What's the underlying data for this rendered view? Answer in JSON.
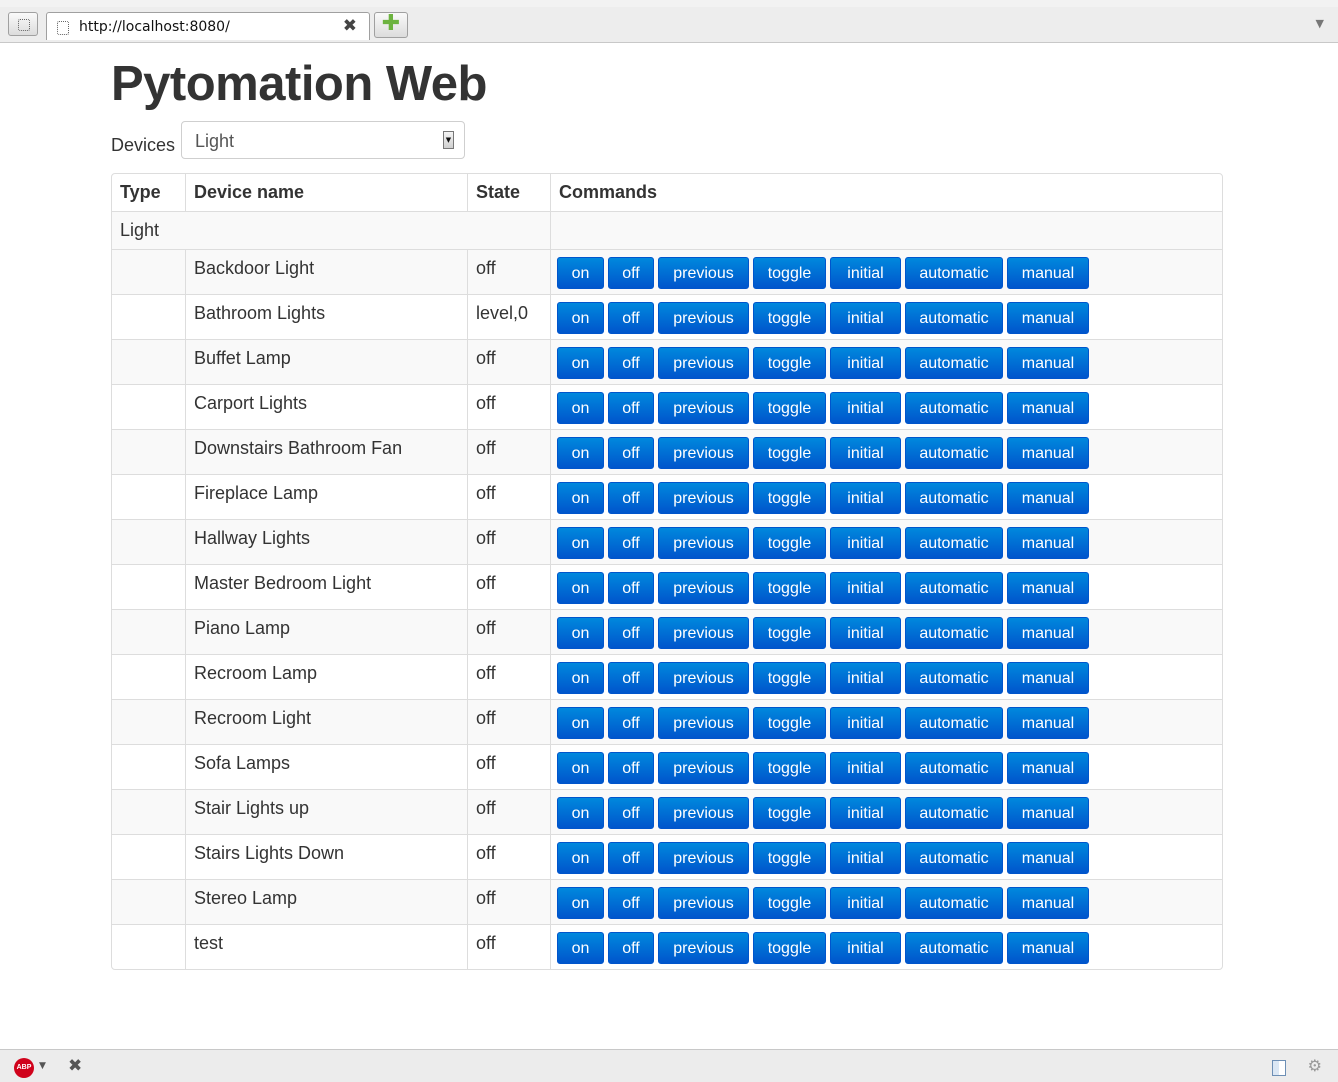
{
  "browser": {
    "tab_title": "http://localhost:8080/",
    "tab_close_glyph": "✖",
    "new_tab_glyph": "✚",
    "menu_glyph": "▼"
  },
  "statusbar": {
    "adblock_label": "ABP",
    "adblock_dropdown_glyph": "▼",
    "stop_glyph": "✖",
    "addon_glyph": "⚙"
  },
  "page": {
    "title": "Pytomation Web",
    "devices_label": "Devices",
    "devices_selected": "Light",
    "select_arrow_glyph": "▼"
  },
  "table": {
    "headers": {
      "type": "Type",
      "name": "Device name",
      "state": "State",
      "commands": "Commands"
    },
    "group": "Light",
    "commands": [
      "on",
      "off",
      "previous",
      "toggle",
      "initial",
      "automatic",
      "manual"
    ],
    "devices": [
      {
        "name": "Backdoor Light",
        "state": "off"
      },
      {
        "name": "Bathroom Lights",
        "state": "level,0"
      },
      {
        "name": "Buffet Lamp",
        "state": "off"
      },
      {
        "name": "Carport Lights",
        "state": "off"
      },
      {
        "name": "Downstairs Bathroom Fan",
        "state": "off"
      },
      {
        "name": "Fireplace Lamp",
        "state": "off"
      },
      {
        "name": "Hallway Lights",
        "state": "off"
      },
      {
        "name": "Master Bedroom Light",
        "state": "off"
      },
      {
        "name": "Piano Lamp",
        "state": "off"
      },
      {
        "name": "Recroom Lamp",
        "state": "off"
      },
      {
        "name": "Recroom Light",
        "state": "off"
      },
      {
        "name": "Sofa Lamps",
        "state": "off"
      },
      {
        "name": "Stair Lights up",
        "state": "off"
      },
      {
        "name": "Stairs Lights Down",
        "state": "off"
      },
      {
        "name": "Stereo Lamp",
        "state": "off"
      },
      {
        "name": "test",
        "state": "off"
      }
    ]
  },
  "colors": {
    "button_top": "#0088dd",
    "button_bottom": "#0055cc",
    "button_text": "#ffffff",
    "table_border": "#dddddd",
    "stripe": "#f9f9f9"
  }
}
